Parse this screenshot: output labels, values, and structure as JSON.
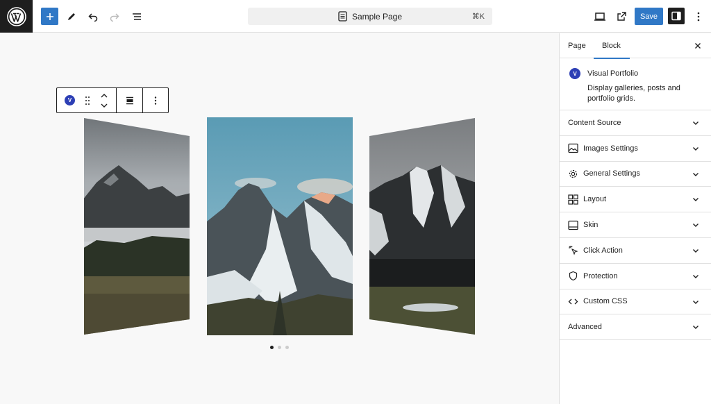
{
  "topbar": {
    "logo": "wordpress-logo",
    "add_icon": "plus-icon",
    "tools_icon": "pencil-icon",
    "undo_icon": "undo-icon",
    "redo_icon": "redo-icon",
    "list_view_icon": "list-view-icon",
    "command_bar": {
      "title": "Sample Page",
      "shortcut": "⌘K"
    },
    "preview_icon": "desktop-preview-icon",
    "view_page_icon": "external-link-icon",
    "save_label": "Save",
    "settings_icon": "sidebar-toggle-icon",
    "options_icon": "more-vertical-icon"
  },
  "block_toolbar": {
    "badge_letter": "V",
    "items": [
      "visual-portfolio-icon",
      "drag-handle-icon",
      "move-up-down-icon",
      "align-icon",
      "more-options-icon"
    ]
  },
  "gallery": {
    "slides": [
      {
        "name": "foggy-mountain-forest"
      },
      {
        "name": "snowy-peak-sunrise"
      },
      {
        "name": "dark-snowy-mountain"
      }
    ],
    "pagination": {
      "count": 3,
      "active": 0
    }
  },
  "sidebar": {
    "tabs": [
      {
        "label": "Page",
        "active": false
      },
      {
        "label": "Block",
        "active": true
      }
    ],
    "block": {
      "badge_letter": "V",
      "name": "Visual Portfolio",
      "description": "Display galleries, posts and portfolio grids."
    },
    "panels": [
      {
        "label": "Content Source",
        "icon": ""
      },
      {
        "label": "Images Settings",
        "icon": "images-icon"
      },
      {
        "label": "General Settings",
        "icon": "gear-icon"
      },
      {
        "label": "Layout",
        "icon": "layout-grid-icon"
      },
      {
        "label": "Skin",
        "icon": "skin-icon"
      },
      {
        "label": "Click Action",
        "icon": "cursor-click-icon"
      },
      {
        "label": "Protection",
        "icon": "shield-icon"
      },
      {
        "label": "Custom CSS",
        "icon": "code-icon"
      },
      {
        "label": "Advanced",
        "icon": ""
      }
    ]
  },
  "colors": {
    "accent": "#3078c6",
    "badge": "#2d3fb5",
    "dark": "#1e1e1e"
  }
}
